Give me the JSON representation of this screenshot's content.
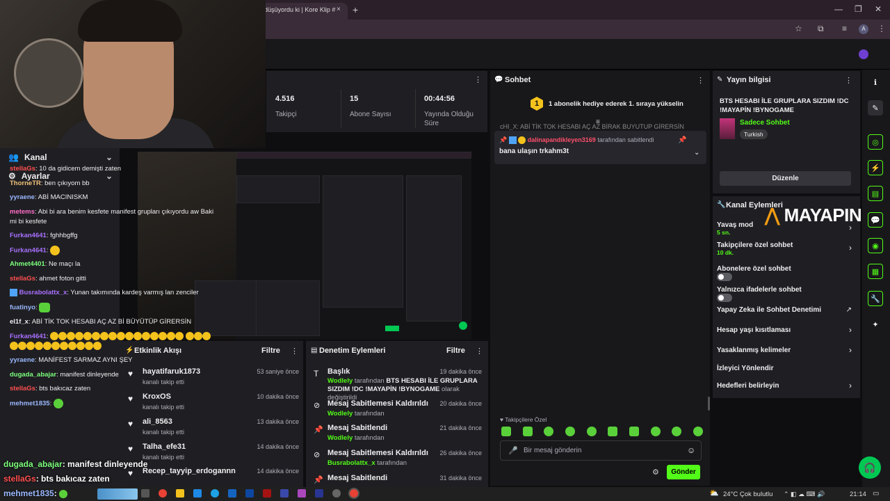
{
  "browser": {
    "tab_title": "düşüyordu ki | Kore Klip #",
    "tab_close": "×",
    "new_tab": "+",
    "window_controls": [
      "—",
      "❐",
      "✕"
    ]
  },
  "sidebar": {
    "items": [
      {
        "label": "Kanal",
        "icon": "users-icon"
      },
      {
        "label": "Ayarlar",
        "icon": "gear-icon"
      }
    ]
  },
  "stats": [
    {
      "value": "4.516",
      "label": "Takipçi"
    },
    {
      "value": "15",
      "label": "Abone Sayısı"
    },
    {
      "value": "00:44:56",
      "label": "Yayında Olduğu Süre"
    }
  ],
  "activity": {
    "title": "Etkinlik Akışı",
    "filter": "Filtre",
    "items": [
      {
        "name": "hayatifaruk1873",
        "sub": "kanalı takip etti",
        "time": "53 saniye önce"
      },
      {
        "name": "KroxOS",
        "sub": "kanalı takip etti",
        "time": "10 dakika önce"
      },
      {
        "name": "ali_8563",
        "sub": "kanalı takip etti",
        "time": "13 dakika önce"
      },
      {
        "name": "Talha_efe31",
        "sub": "kanalı takip etti",
        "time": "14 dakika önce"
      },
      {
        "name": "Recep_tayyip_erdogannn",
        "sub": "",
        "time": "14 dakika önce"
      }
    ]
  },
  "moderation": {
    "title": "Denetim Eylemleri",
    "filter": "Filtre",
    "items": [
      {
        "title": "Başlık",
        "user": "Wodlely",
        "by": "tarafından",
        "detail": "BTS HESABI İLE GRUPLARA SIZDIM !DC !MAYAPİN !BYNOGAME",
        "suffix": "olarak değiştirildi",
        "time": "19 dakika önce"
      },
      {
        "title": "Mesaj Sabitlemesi Kaldırıldı",
        "user": "Wodlely",
        "by": "tarafından",
        "time": "20 dakika önce"
      },
      {
        "title": "Mesaj Sabitlendi",
        "user": "Wodlely",
        "by": "tarafından",
        "time": "21 dakika önce"
      },
      {
        "title": "Mesaj Sabitlemesi Kaldırıldı",
        "user": "Busrabolattx_x",
        "by": "tarafından",
        "time": "26 dakika önce"
      },
      {
        "title": "Mesaj Sabitlendi",
        "user": "",
        "by": "",
        "time": "31 dakika önce"
      }
    ]
  },
  "chat": {
    "title": "Sohbet",
    "banner": "1 abonelik hediye ederek 1. sıraya yükselin",
    "banner_badge": "1",
    "cutoff": "cHI_X: ABİ TİK TOK HESABI AÇ AZ BİRAK BUYUTUP GİRERSİN",
    "pinned_user": "dalinapandikleyen3169",
    "pinned_by": "tarafından sabitlendi",
    "pinned_text": "bana ulaşın trkahm3t",
    "messages": [
      {
        "user": "stellaGs",
        "color": "#ff4f4f",
        "text": ": 10 da gidicem demişti zaten"
      },
      {
        "user": "ThorneTR",
        "color": "#f4c27a",
        "text": ": ben çıkıyom bb"
      },
      {
        "user": "yyraene",
        "color": "#9bb8ff",
        "text": ": ABİ MACINISKM"
      },
      {
        "user": "metems",
        "color": "#ff6ec7",
        "text": ": Abi bi ara benim kesfete manifest grupları çıkıyordu aw Baki mi bi kesfete"
      },
      {
        "user": "Furkan4641",
        "color": "#a970ff",
        "text": ": fghhbgffg"
      },
      {
        "user": "Furkan4641",
        "color": "#a970ff",
        "text": ":"
      },
      {
        "user": "Ahmet4401",
        "color": "#7cff7c",
        "text": ": Ne maçı la"
      },
      {
        "user": "stellaGs",
        "color": "#ff4f4f",
        "text": ": ahmet foton gitti"
      },
      {
        "user": "Busrabolattx_x",
        "color": "#a970ff",
        "text": ": Yunan takımında kardeş varmış lan zenciler"
      },
      {
        "user": "fuatinyo",
        "color": "#9bb8ff",
        "text": ":"
      },
      {
        "user": "el1f_x",
        "color": "#efeff1",
        "text": ": ABİ TİK TOK HESABI AÇ AZ Bİ BÜYÜTÜP GİRERSİN"
      },
      {
        "user": "Furkan4641",
        "color": "#a970ff",
        "text": ":"
      },
      {
        "user": "yyraene",
        "color": "#9bb8ff",
        "text": ": MANİFEST SARMAZ AYNI ŞEY"
      },
      {
        "user": "dugada_abajar",
        "color": "#7cff7c",
        "text": ": manifest dinleyende"
      },
      {
        "user": "stellaGs",
        "color": "#ff4f4f",
        "text": ": bts bakıcaz zaten"
      },
      {
        "user": "mehmet1835",
        "color": "#9bb8ff",
        "text": ":"
      }
    ],
    "emote_row_label": "Takipçilere Özel",
    "input_placeholder": "Bir mesaj gönderin",
    "send": "Gönder"
  },
  "stream_info": {
    "title": "Yayın bilgisi",
    "stream_title": "BTS HESABI İLE GRUPLARA SIZDIM !DC !MAYAPİN !BYNOGAME",
    "category": "Sadece Sohbet",
    "tag": "Turkish",
    "edit": "Düzenle"
  },
  "channel_actions": {
    "title": "Kanal Eylemleri",
    "items": [
      {
        "label": "Yavaş mod",
        "sub": "5 sn.",
        "control": "chevron"
      },
      {
        "label": "Takipçilere özel sohbet",
        "sub": "10 dk.",
        "control": "chevron"
      },
      {
        "label": "Abonelere özel sohbet",
        "sub": "",
        "control": "toggle"
      },
      {
        "label": "Yalnızca ifadelerle sohbet",
        "sub": "",
        "control": "toggle"
      },
      {
        "label": "Yapay Zeka ile Sohbet Denetimi",
        "sub": "",
        "control": "external"
      },
      {
        "label": "Hesap yaşı kısıtlaması",
        "sub": "",
        "control": "chevron"
      },
      {
        "label": "Yasaklanmış kelimeler",
        "sub": "",
        "control": "chevron"
      },
      {
        "label": "İzleyici Yönlendir",
        "sub": "",
        "control": "none"
      },
      {
        "label": "Hedefleri belirleyin",
        "sub": "",
        "control": "chevron"
      }
    ]
  },
  "watermark": "MAYAPIN",
  "overlay_chat": [
    {
      "user": "dugada_abajar",
      "color": "#7cff7c",
      "text": ": manifest dinleyende"
    },
    {
      "user": "stellaGs",
      "color": "#ff4f4f",
      "text": ": bts bakıcaz zaten"
    },
    {
      "user": "mehmet1835",
      "color": "#9bb8ff",
      "text": ":"
    }
  ],
  "taskbar": {
    "weather": "24°C  Çok bulutlu",
    "clock": "21:14"
  },
  "colors": {
    "accent_green": "#00c853",
    "username_green": "#53fc18",
    "panel": "#1f1f23"
  }
}
